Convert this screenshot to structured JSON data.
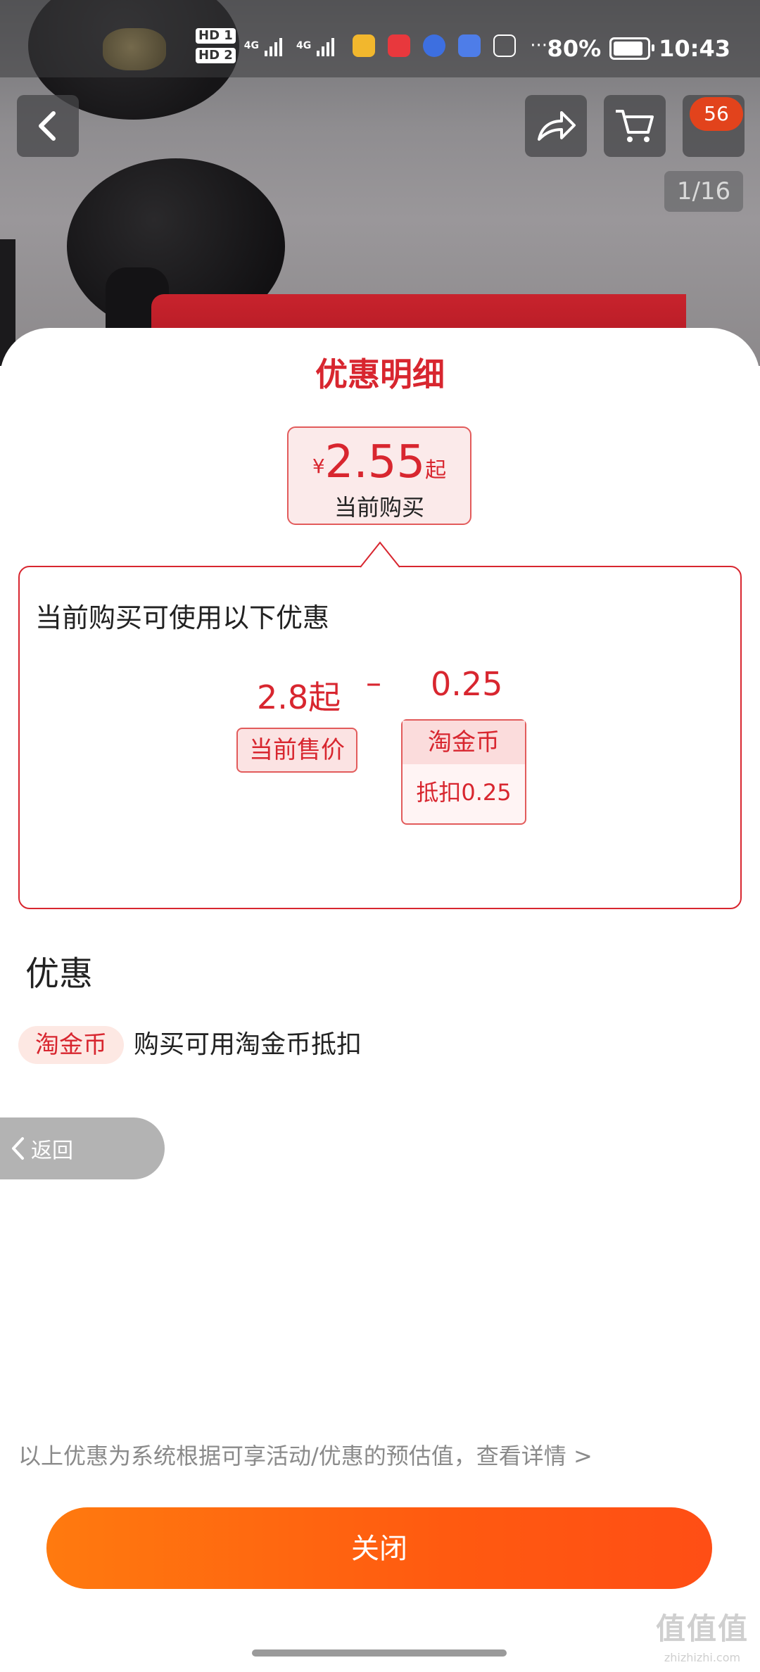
{
  "status_bar": {
    "sim1": "HD 1",
    "sim2": "HD 2",
    "network1": "4G",
    "network2": "4G",
    "battery": "80%",
    "battery_level": 0.8,
    "time": "10:43"
  },
  "product_toolbar": {
    "back_icon": "chevron-left-icon",
    "share_icon": "share-icon",
    "cart_icon": "cart-icon",
    "cart_badge": "56",
    "image_counter": "1/16"
  },
  "sheet": {
    "title": "优惠明细",
    "price": {
      "symbol": "¥",
      "value": "2.55",
      "suffix": "起",
      "caption": "当前购买"
    },
    "detail": {
      "heading": "当前购买可使用以下优惠",
      "current_price": "2.8起",
      "current_price_label": "当前售价",
      "operator": "–",
      "deduction": "0.25",
      "deduction_label": "淘金币",
      "deduction_note": "抵扣0.25"
    },
    "section_title": "优惠",
    "coupon": {
      "tag": "淘金币",
      "description": "购买可用淘金币抵扣"
    },
    "back_label": "返回",
    "footnote": "以上优惠为系统根据可享活动/优惠的预估值，查看详情 >",
    "close_label": "关闭"
  },
  "colors": {
    "accent_red": "#d8262f",
    "button_orange_start": "#ff7a0f",
    "button_orange_end": "#ff4e15"
  },
  "watermark": {
    "text": "值值值",
    "sub": "zhizhizhi.com"
  }
}
